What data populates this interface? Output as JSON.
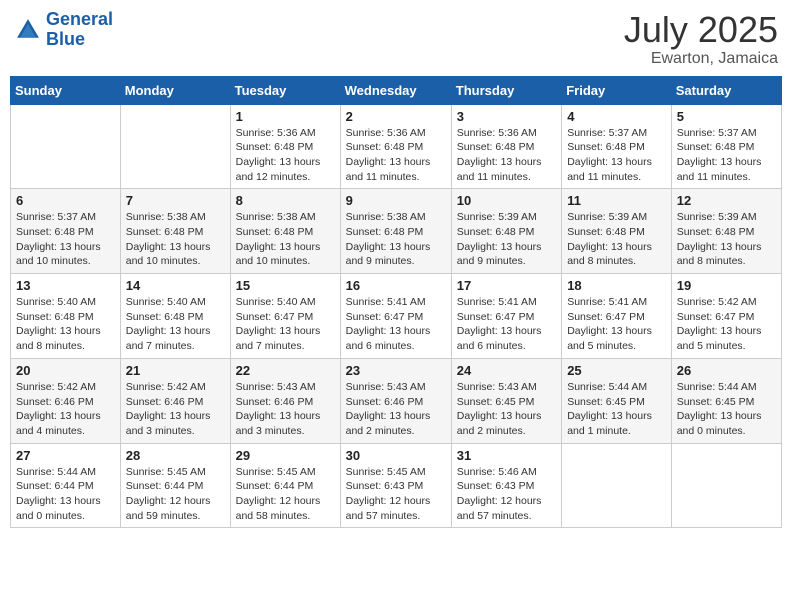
{
  "header": {
    "logo_line1": "General",
    "logo_line2": "Blue",
    "month_year": "July 2025",
    "location": "Ewarton, Jamaica"
  },
  "weekdays": [
    "Sunday",
    "Monday",
    "Tuesday",
    "Wednesday",
    "Thursday",
    "Friday",
    "Saturday"
  ],
  "weeks": [
    [
      {
        "day": "",
        "info": ""
      },
      {
        "day": "",
        "info": ""
      },
      {
        "day": "1",
        "info": "Sunrise: 5:36 AM\nSunset: 6:48 PM\nDaylight: 13 hours\nand 12 minutes."
      },
      {
        "day": "2",
        "info": "Sunrise: 5:36 AM\nSunset: 6:48 PM\nDaylight: 13 hours\nand 11 minutes."
      },
      {
        "day": "3",
        "info": "Sunrise: 5:36 AM\nSunset: 6:48 PM\nDaylight: 13 hours\nand 11 minutes."
      },
      {
        "day": "4",
        "info": "Sunrise: 5:37 AM\nSunset: 6:48 PM\nDaylight: 13 hours\nand 11 minutes."
      },
      {
        "day": "5",
        "info": "Sunrise: 5:37 AM\nSunset: 6:48 PM\nDaylight: 13 hours\nand 11 minutes."
      }
    ],
    [
      {
        "day": "6",
        "info": "Sunrise: 5:37 AM\nSunset: 6:48 PM\nDaylight: 13 hours\nand 10 minutes."
      },
      {
        "day": "7",
        "info": "Sunrise: 5:38 AM\nSunset: 6:48 PM\nDaylight: 13 hours\nand 10 minutes."
      },
      {
        "day": "8",
        "info": "Sunrise: 5:38 AM\nSunset: 6:48 PM\nDaylight: 13 hours\nand 10 minutes."
      },
      {
        "day": "9",
        "info": "Sunrise: 5:38 AM\nSunset: 6:48 PM\nDaylight: 13 hours\nand 9 minutes."
      },
      {
        "day": "10",
        "info": "Sunrise: 5:39 AM\nSunset: 6:48 PM\nDaylight: 13 hours\nand 9 minutes."
      },
      {
        "day": "11",
        "info": "Sunrise: 5:39 AM\nSunset: 6:48 PM\nDaylight: 13 hours\nand 8 minutes."
      },
      {
        "day": "12",
        "info": "Sunrise: 5:39 AM\nSunset: 6:48 PM\nDaylight: 13 hours\nand 8 minutes."
      }
    ],
    [
      {
        "day": "13",
        "info": "Sunrise: 5:40 AM\nSunset: 6:48 PM\nDaylight: 13 hours\nand 8 minutes."
      },
      {
        "day": "14",
        "info": "Sunrise: 5:40 AM\nSunset: 6:48 PM\nDaylight: 13 hours\nand 7 minutes."
      },
      {
        "day": "15",
        "info": "Sunrise: 5:40 AM\nSunset: 6:47 PM\nDaylight: 13 hours\nand 7 minutes."
      },
      {
        "day": "16",
        "info": "Sunrise: 5:41 AM\nSunset: 6:47 PM\nDaylight: 13 hours\nand 6 minutes."
      },
      {
        "day": "17",
        "info": "Sunrise: 5:41 AM\nSunset: 6:47 PM\nDaylight: 13 hours\nand 6 minutes."
      },
      {
        "day": "18",
        "info": "Sunrise: 5:41 AM\nSunset: 6:47 PM\nDaylight: 13 hours\nand 5 minutes."
      },
      {
        "day": "19",
        "info": "Sunrise: 5:42 AM\nSunset: 6:47 PM\nDaylight: 13 hours\nand 5 minutes."
      }
    ],
    [
      {
        "day": "20",
        "info": "Sunrise: 5:42 AM\nSunset: 6:46 PM\nDaylight: 13 hours\nand 4 minutes."
      },
      {
        "day": "21",
        "info": "Sunrise: 5:42 AM\nSunset: 6:46 PM\nDaylight: 13 hours\nand 3 minutes."
      },
      {
        "day": "22",
        "info": "Sunrise: 5:43 AM\nSunset: 6:46 PM\nDaylight: 13 hours\nand 3 minutes."
      },
      {
        "day": "23",
        "info": "Sunrise: 5:43 AM\nSunset: 6:46 PM\nDaylight: 13 hours\nand 2 minutes."
      },
      {
        "day": "24",
        "info": "Sunrise: 5:43 AM\nSunset: 6:45 PM\nDaylight: 13 hours\nand 2 minutes."
      },
      {
        "day": "25",
        "info": "Sunrise: 5:44 AM\nSunset: 6:45 PM\nDaylight: 13 hours\nand 1 minute."
      },
      {
        "day": "26",
        "info": "Sunrise: 5:44 AM\nSunset: 6:45 PM\nDaylight: 13 hours\nand 0 minutes."
      }
    ],
    [
      {
        "day": "27",
        "info": "Sunrise: 5:44 AM\nSunset: 6:44 PM\nDaylight: 13 hours\nand 0 minutes."
      },
      {
        "day": "28",
        "info": "Sunrise: 5:45 AM\nSunset: 6:44 PM\nDaylight: 12 hours\nand 59 minutes."
      },
      {
        "day": "29",
        "info": "Sunrise: 5:45 AM\nSunset: 6:44 PM\nDaylight: 12 hours\nand 58 minutes."
      },
      {
        "day": "30",
        "info": "Sunrise: 5:45 AM\nSunset: 6:43 PM\nDaylight: 12 hours\nand 57 minutes."
      },
      {
        "day": "31",
        "info": "Sunrise: 5:46 AM\nSunset: 6:43 PM\nDaylight: 12 hours\nand 57 minutes."
      },
      {
        "day": "",
        "info": ""
      },
      {
        "day": "",
        "info": ""
      }
    ]
  ]
}
